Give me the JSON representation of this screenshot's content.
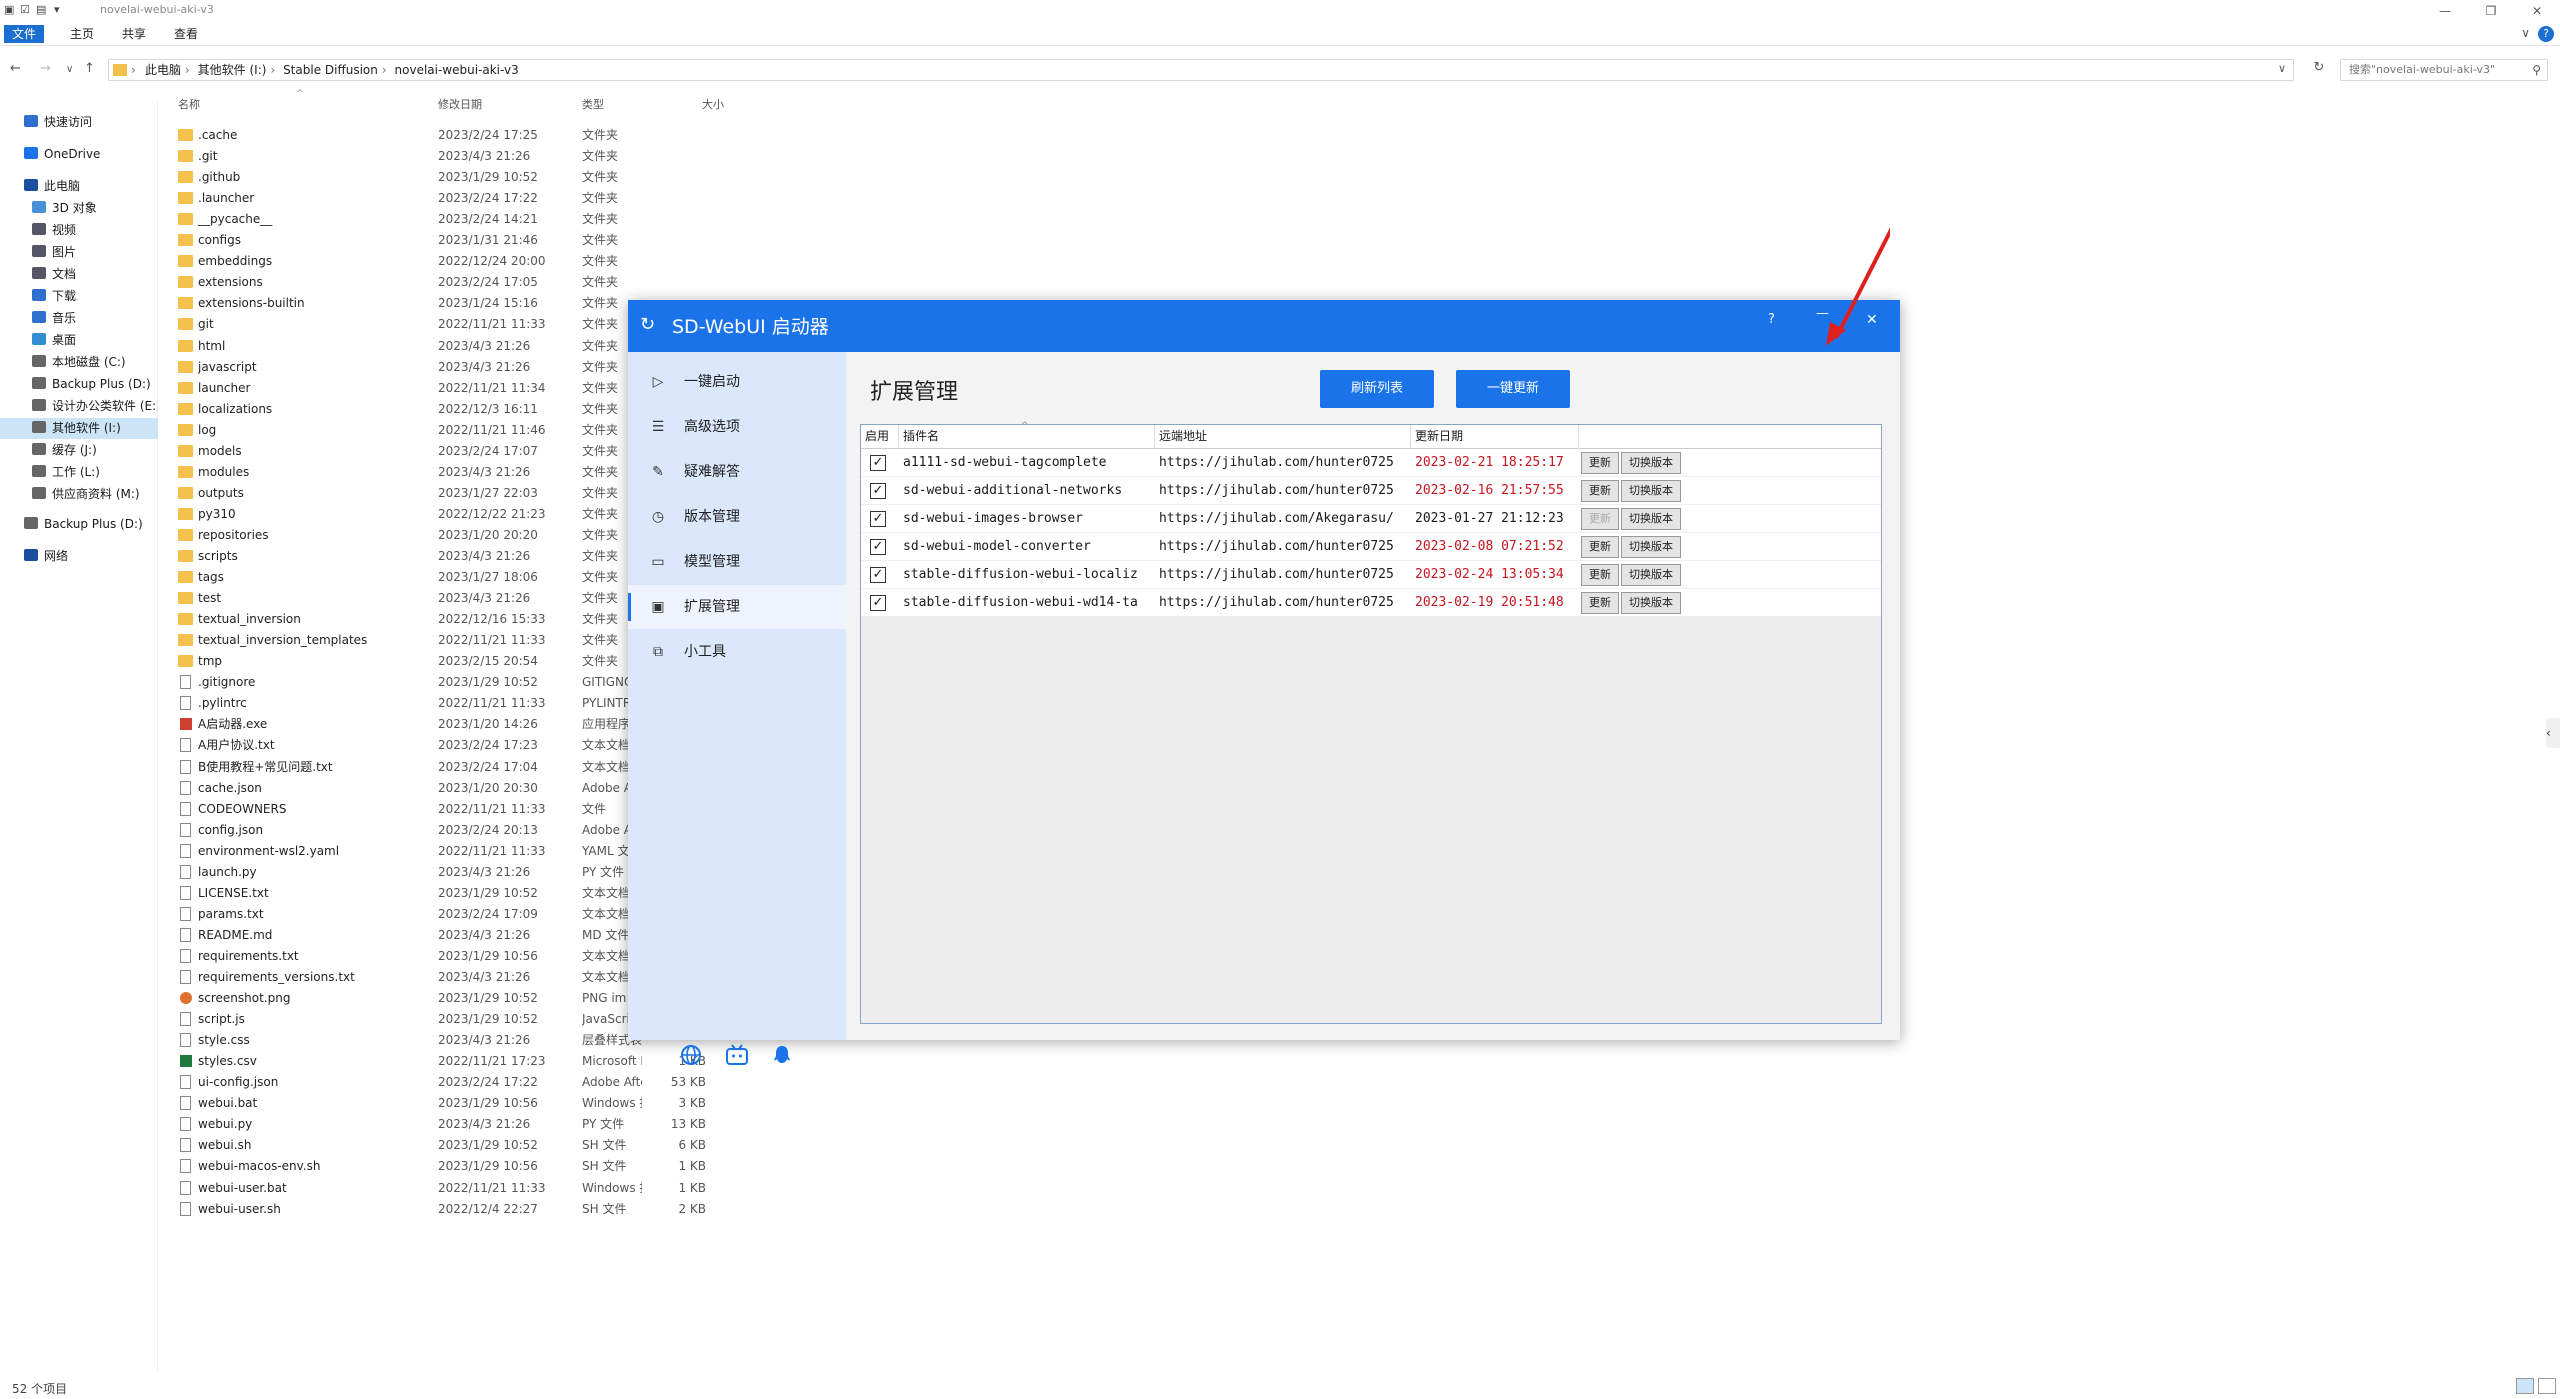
{
  "window": {
    "title": "novelai-webui-aki-v3",
    "quick_access": [
      "▣",
      "☑",
      "▤",
      "▾"
    ]
  },
  "ribbon": {
    "tabs": [
      "文件",
      "主页",
      "共享",
      "查看"
    ],
    "help": "?",
    "expand": "∨"
  },
  "address": {
    "crumbs": [
      "此电脑",
      "其他软件 (I:)",
      "Stable Diffusion",
      "novelai-webui-aki-v3"
    ],
    "search_placeholder": "搜索\"novelai-webui-aki-v3\""
  },
  "sidebar": {
    "items": [
      {
        "label": "快速访问",
        "icon": "star-icon",
        "color": "#2f6fd0",
        "indent": 1
      },
      {
        "label": "OneDrive",
        "icon": "cloud-icon",
        "color": "#1a73e8",
        "indent": 1
      },
      {
        "label": "此电脑",
        "icon": "pc-icon",
        "color": "#1a4fa0",
        "indent": 1
      },
      {
        "label": "3D 对象",
        "icon": "cube-icon",
        "color": "#4a90d9",
        "indent": 2
      },
      {
        "label": "视频",
        "icon": "video-icon",
        "color": "#556",
        "indent": 2
      },
      {
        "label": "图片",
        "icon": "picture-icon",
        "color": "#556",
        "indent": 2
      },
      {
        "label": "文档",
        "icon": "document-icon",
        "color": "#556",
        "indent": 2
      },
      {
        "label": "下载",
        "icon": "download-icon",
        "color": "#2f6fd0",
        "indent": 2
      },
      {
        "label": "音乐",
        "icon": "music-icon",
        "color": "#2f6fd0",
        "indent": 2
      },
      {
        "label": "桌面",
        "icon": "desktop-icon",
        "color": "#2f8fd0",
        "indent": 2
      },
      {
        "label": "本地磁盘 (C:)",
        "icon": "drive-icon",
        "color": "#666",
        "indent": 2
      },
      {
        "label": "Backup Plus (D:)",
        "icon": "drive-icon",
        "color": "#666",
        "indent": 2
      },
      {
        "label": "设计办公类软件 (E:",
        "icon": "drive-icon",
        "color": "#666",
        "indent": 2
      },
      {
        "label": "其他软件 (I:)",
        "icon": "drive-icon",
        "color": "#666",
        "indent": 2,
        "selected": true
      },
      {
        "label": "缓存 (J:)",
        "icon": "drive-icon",
        "color": "#666",
        "indent": 2
      },
      {
        "label": "工作 (L:)",
        "icon": "drive-icon",
        "color": "#666",
        "indent": 2
      },
      {
        "label": "供应商资料 (M:)",
        "icon": "drive-icon",
        "color": "#666",
        "indent": 2
      },
      {
        "label": "Backup Plus (D:)",
        "icon": "drive-icon",
        "color": "#666",
        "indent": 1
      },
      {
        "label": "网络",
        "icon": "network-icon",
        "color": "#1a4fa0",
        "indent": 1
      }
    ]
  },
  "filelist": {
    "columns": [
      "名称",
      "修改日期",
      "类型",
      "大小"
    ],
    "rows": [
      {
        "name": ".cache",
        "date": "2023/2/24 17:25",
        "type": "文件夹",
        "size": "",
        "kind": "folder"
      },
      {
        "name": ".git",
        "date": "2023/4/3 21:26",
        "type": "文件夹",
        "size": "",
        "kind": "folder"
      },
      {
        "name": ".github",
        "date": "2023/1/29 10:52",
        "type": "文件夹",
        "size": "",
        "kind": "folder"
      },
      {
        "name": ".launcher",
        "date": "2023/2/24 17:22",
        "type": "文件夹",
        "size": "",
        "kind": "folder"
      },
      {
        "name": "__pycache__",
        "date": "2023/2/24 14:21",
        "type": "文件夹",
        "size": "",
        "kind": "folder"
      },
      {
        "name": "configs",
        "date": "2023/1/31 21:46",
        "type": "文件夹",
        "size": "",
        "kind": "folder"
      },
      {
        "name": "embeddings",
        "date": "2022/12/24 20:00",
        "type": "文件夹",
        "size": "",
        "kind": "folder"
      },
      {
        "name": "extensions",
        "date": "2023/2/24 17:05",
        "type": "文件夹",
        "size": "",
        "kind": "folder"
      },
      {
        "name": "extensions-builtin",
        "date": "2023/1/24 15:16",
        "type": "文件夹",
        "size": "",
        "kind": "folder"
      },
      {
        "name": "git",
        "date": "2022/11/21 11:33",
        "type": "文件夹",
        "size": "",
        "kind": "folder"
      },
      {
        "name": "html",
        "date": "2023/4/3 21:26",
        "type": "文件夹",
        "size": "",
        "kind": "folder"
      },
      {
        "name": "javascript",
        "date": "2023/4/3 21:26",
        "type": "文件夹",
        "size": "",
        "kind": "folder"
      },
      {
        "name": "launcher",
        "date": "2022/11/21 11:34",
        "type": "文件夹",
        "size": "",
        "kind": "folder"
      },
      {
        "name": "localizations",
        "date": "2022/12/3 16:11",
        "type": "文件夹",
        "size": "",
        "kind": "folder"
      },
      {
        "name": "log",
        "date": "2022/11/21 11:46",
        "type": "文件夹",
        "size": "",
        "kind": "folder"
      },
      {
        "name": "models",
        "date": "2023/2/24 17:07",
        "type": "文件夹",
        "size": "",
        "kind": "folder"
      },
      {
        "name": "modules",
        "date": "2023/4/3 21:26",
        "type": "文件夹",
        "size": "",
        "kind": "folder"
      },
      {
        "name": "outputs",
        "date": "2023/1/27 22:03",
        "type": "文件夹",
        "size": "",
        "kind": "folder"
      },
      {
        "name": "py310",
        "date": "2022/12/22 21:23",
        "type": "文件夹",
        "size": "",
        "kind": "folder"
      },
      {
        "name": "repositories",
        "date": "2023/1/20 20:20",
        "type": "文件夹",
        "size": "",
        "kind": "folder"
      },
      {
        "name": "scripts",
        "date": "2023/4/3 21:26",
        "type": "文件夹",
        "size": "",
        "kind": "folder"
      },
      {
        "name": "tags",
        "date": "2023/1/27 18:06",
        "type": "文件夹",
        "size": "",
        "kind": "folder"
      },
      {
        "name": "test",
        "date": "2023/4/3 21:26",
        "type": "文件夹",
        "size": "",
        "kind": "folder"
      },
      {
        "name": "textual_inversion",
        "date": "2022/12/16 15:33",
        "type": "文件夹",
        "size": "",
        "kind": "folder"
      },
      {
        "name": "textual_inversion_templates",
        "date": "2022/11/21 11:33",
        "type": "文件夹",
        "size": "",
        "kind": "folder"
      },
      {
        "name": "tmp",
        "date": "2023/2/15 20:54",
        "type": "文件夹",
        "size": "",
        "kind": "folder"
      },
      {
        "name": ".gitignore",
        "date": "2023/1/29 10:52",
        "type": "GITIGNO",
        "size": "",
        "kind": "file"
      },
      {
        "name": ".pylintrc",
        "date": "2022/11/21 11:33",
        "type": "PYLINTR",
        "size": "",
        "kind": "file"
      },
      {
        "name": "A启动器.exe",
        "date": "2023/1/20 14:26",
        "type": "应用程序",
        "size": "",
        "kind": "exe"
      },
      {
        "name": "A用户协议.txt",
        "date": "2023/2/24 17:23",
        "type": "文本文档",
        "size": "",
        "kind": "file"
      },
      {
        "name": "B使用教程+常见问题.txt",
        "date": "2023/2/24 17:04",
        "type": "文本文档",
        "size": "",
        "kind": "file"
      },
      {
        "name": "cache.json",
        "date": "2023/1/20 20:30",
        "type": "Adobe A",
        "size": "",
        "kind": "file"
      },
      {
        "name": "CODEOWNERS",
        "date": "2022/11/21 11:33",
        "type": "文件",
        "size": "",
        "kind": "file"
      },
      {
        "name": "config.json",
        "date": "2023/2/24 20:13",
        "type": "Adobe A",
        "size": "",
        "kind": "file"
      },
      {
        "name": "environment-wsl2.yaml",
        "date": "2022/11/21 11:33",
        "type": "YAML 文",
        "size": "",
        "kind": "file"
      },
      {
        "name": "launch.py",
        "date": "2023/4/3 21:26",
        "type": "PY 文件",
        "size": "",
        "kind": "file"
      },
      {
        "name": "LICENSE.txt",
        "date": "2023/1/29 10:52",
        "type": "文本文档",
        "size": "",
        "kind": "file"
      },
      {
        "name": "params.txt",
        "date": "2023/2/24 17:09",
        "type": "文本文档",
        "size": "",
        "kind": "file"
      },
      {
        "name": "README.md",
        "date": "2023/4/3 21:26",
        "type": "MD 文件",
        "size": "",
        "kind": "file"
      },
      {
        "name": "requirements.txt",
        "date": "2023/1/29 10:56",
        "type": "文本文档",
        "size": "",
        "kind": "file"
      },
      {
        "name": "requirements_versions.txt",
        "date": "2023/4/3 21:26",
        "type": "文本文档",
        "size": "",
        "kind": "file"
      },
      {
        "name": "screenshot.png",
        "date": "2023/1/29 10:52",
        "type": "PNG im",
        "size": "",
        "kind": "png"
      },
      {
        "name": "script.js",
        "date": "2023/1/29 10:52",
        "type": "JavaScri",
        "size": "",
        "kind": "file"
      },
      {
        "name": "style.css",
        "date": "2023/4/3 21:26",
        "type": "层叠样式表文档",
        "size": "",
        "kind": "file"
      },
      {
        "name": "styles.csv",
        "date": "2022/11/21 17:23",
        "type": "Microsoft Excel ...",
        "size": "1 KB",
        "kind": "csv"
      },
      {
        "name": "ui-config.json",
        "date": "2023/2/24 17:22",
        "type": "Adobe After Effe...",
        "size": "53 KB",
        "kind": "file"
      },
      {
        "name": "webui.bat",
        "date": "2023/1/29 10:56",
        "type": "Windows 批处理...",
        "size": "3 KB",
        "kind": "file"
      },
      {
        "name": "webui.py",
        "date": "2023/4/3 21:26",
        "type": "PY 文件",
        "size": "13 KB",
        "kind": "file"
      },
      {
        "name": "webui.sh",
        "date": "2023/1/29 10:52",
        "type": "SH 文件",
        "size": "6 KB",
        "kind": "file"
      },
      {
        "name": "webui-macos-env.sh",
        "date": "2023/1/29 10:56",
        "type": "SH 文件",
        "size": "1 KB",
        "kind": "file"
      },
      {
        "name": "webui-user.bat",
        "date": "2022/11/21 11:33",
        "type": "Windows 批处理...",
        "size": "1 KB",
        "kind": "file"
      },
      {
        "name": "webui-user.sh",
        "date": "2022/12/4 22:27",
        "type": "SH 文件",
        "size": "2 KB",
        "kind": "file"
      }
    ]
  },
  "status": {
    "count": "52 个项目"
  },
  "launcher": {
    "title": "SD-WebUI 启动器",
    "header_buttons": [
      "?",
      "—",
      "✕"
    ],
    "nav": [
      {
        "label": "一键启动",
        "icon": "play-icon",
        "glyph": "▷"
      },
      {
        "label": "高级选项",
        "icon": "list-icon",
        "glyph": "☰"
      },
      {
        "label": "疑难解答",
        "icon": "wrench-icon",
        "glyph": "✎"
      },
      {
        "label": "版本管理",
        "icon": "history-icon",
        "glyph": "◷"
      },
      {
        "label": "模型管理",
        "icon": "model-icon",
        "glyph": "▭"
      },
      {
        "label": "扩展管理",
        "icon": "extension-icon",
        "glyph": "▣",
        "selected": true
      },
      {
        "label": "小工具",
        "icon": "tools-icon",
        "glyph": "⧉"
      }
    ],
    "footer_icons": [
      "globe-icon",
      "bilibili-icon",
      "qq-icon"
    ],
    "main": {
      "title": "扩展管理",
      "refresh_label": "刷新列表",
      "update_all_label": "一键更新",
      "columns": [
        "启用",
        "插件名",
        "远端地址",
        "更新日期"
      ],
      "rows": [
        {
          "enabled": true,
          "name": "a1111-sd-webui-tagcomplete",
          "url": "https://jihulab.com/hunter0725",
          "date": "2023-02-21 18:25:17",
          "date_red": true,
          "update_label": "更新",
          "update_disabled": false,
          "switch_label": "切换版本"
        },
        {
          "enabled": true,
          "name": "sd-webui-additional-networks",
          "url": "https://jihulab.com/hunter0725",
          "date": "2023-02-16 21:57:55",
          "date_red": true,
          "update_label": "更新",
          "update_disabled": false,
          "switch_label": "切换版本"
        },
        {
          "enabled": true,
          "name": "sd-webui-images-browser",
          "url": "https://jihulab.com/Akegarasu/",
          "date": "2023-01-27 21:12:23",
          "date_red": false,
          "update_label": "更新",
          "update_disabled": true,
          "switch_label": "切换版本"
        },
        {
          "enabled": true,
          "name": "sd-webui-model-converter",
          "url": "https://jihulab.com/hunter0725",
          "date": "2023-02-08 07:21:52",
          "date_red": true,
          "update_label": "更新",
          "update_disabled": false,
          "switch_label": "切换版本"
        },
        {
          "enabled": true,
          "name": "stable-diffusion-webui-localiz",
          "url": "https://jihulab.com/hunter0725",
          "date": "2023-02-24 13:05:34",
          "date_red": true,
          "update_label": "更新",
          "update_disabled": false,
          "switch_label": "切换版本"
        },
        {
          "enabled": true,
          "name": "stable-diffusion-webui-wd14-ta",
          "url": "https://jihulab.com/hunter0725",
          "date": "2023-02-19 20:51:48",
          "date_red": true,
          "update_label": "更新",
          "update_disabled": false,
          "switch_label": "切换版本"
        }
      ]
    }
  },
  "colors": {
    "accent": "#1a73e8",
    "date_red": "#c8141e",
    "arrow": "#e02020",
    "folder": "#f4c24c"
  }
}
